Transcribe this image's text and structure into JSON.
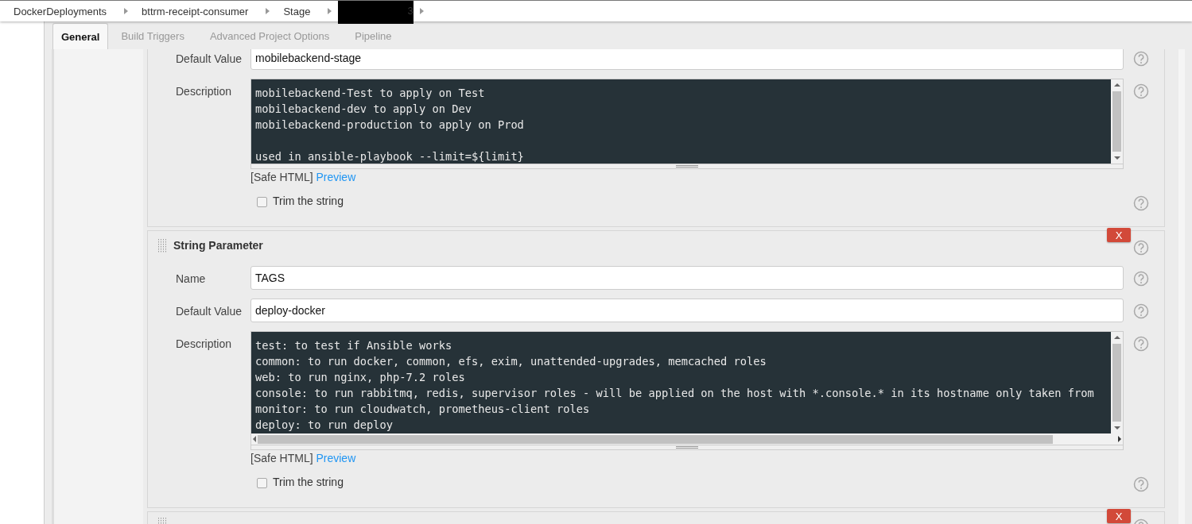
{
  "breadcrumbs": [
    {
      "label": "DockerDeployments",
      "redacted": false
    },
    {
      "label": "bttrm-receipt-consumer",
      "redacted": false
    },
    {
      "label": "Stage",
      "redacted": false
    },
    {
      "label": "3",
      "redacted": true
    }
  ],
  "tabs": [
    {
      "label": "General",
      "selected": true
    },
    {
      "label": "Build Triggers",
      "selected": false
    },
    {
      "label": "Advanced Project Options",
      "selected": false
    },
    {
      "label": "Pipeline",
      "selected": false
    }
  ],
  "parameters": [
    {
      "fields": [
        {
          "kind": "text",
          "label": "Default Value",
          "value": "mobilebackend-stage"
        },
        {
          "kind": "textarea",
          "label": "Description",
          "horizontal_scrollbar": false,
          "text": "mobilebackend-Test to apply on Test\nmobilebackend-dev to apply on Dev\nmobilebackend-production to apply on Prod\n\nused in ansible-playbook --limit=${limit}"
        }
      ],
      "safe_html": "[Safe HTML]",
      "preview": "Preview",
      "trim": {
        "label": "Trim the string",
        "checked": false
      }
    },
    {
      "delete_button": "X",
      "title": "String Parameter",
      "fields": [
        {
          "kind": "text",
          "label": "Name",
          "value": "TAGS"
        },
        {
          "kind": "text",
          "label": "Default Value",
          "value": "deploy-docker"
        },
        {
          "kind": "textarea",
          "label": "Description",
          "horizontal_scrollbar": true,
          "text": "test: to test if Ansible works\ncommon: to run docker, common, efs, exim, unattended-upgrades, memcached roles\nweb: to run nginx, php-7.2 roles\nconsole: to run rabbitmq, redis, supervisor roles - will be applied on the host with *.console.* in its hostname only taken from\nmonitor: to run cloudwatch, prometheus-client roles\ndeploy: to run deploy"
        }
      ],
      "safe_html": "[Safe HTML]",
      "preview": "Preview",
      "trim": {
        "label": "Trim the string",
        "checked": false
      }
    },
    {
      "delete_button": "X"
    }
  ]
}
